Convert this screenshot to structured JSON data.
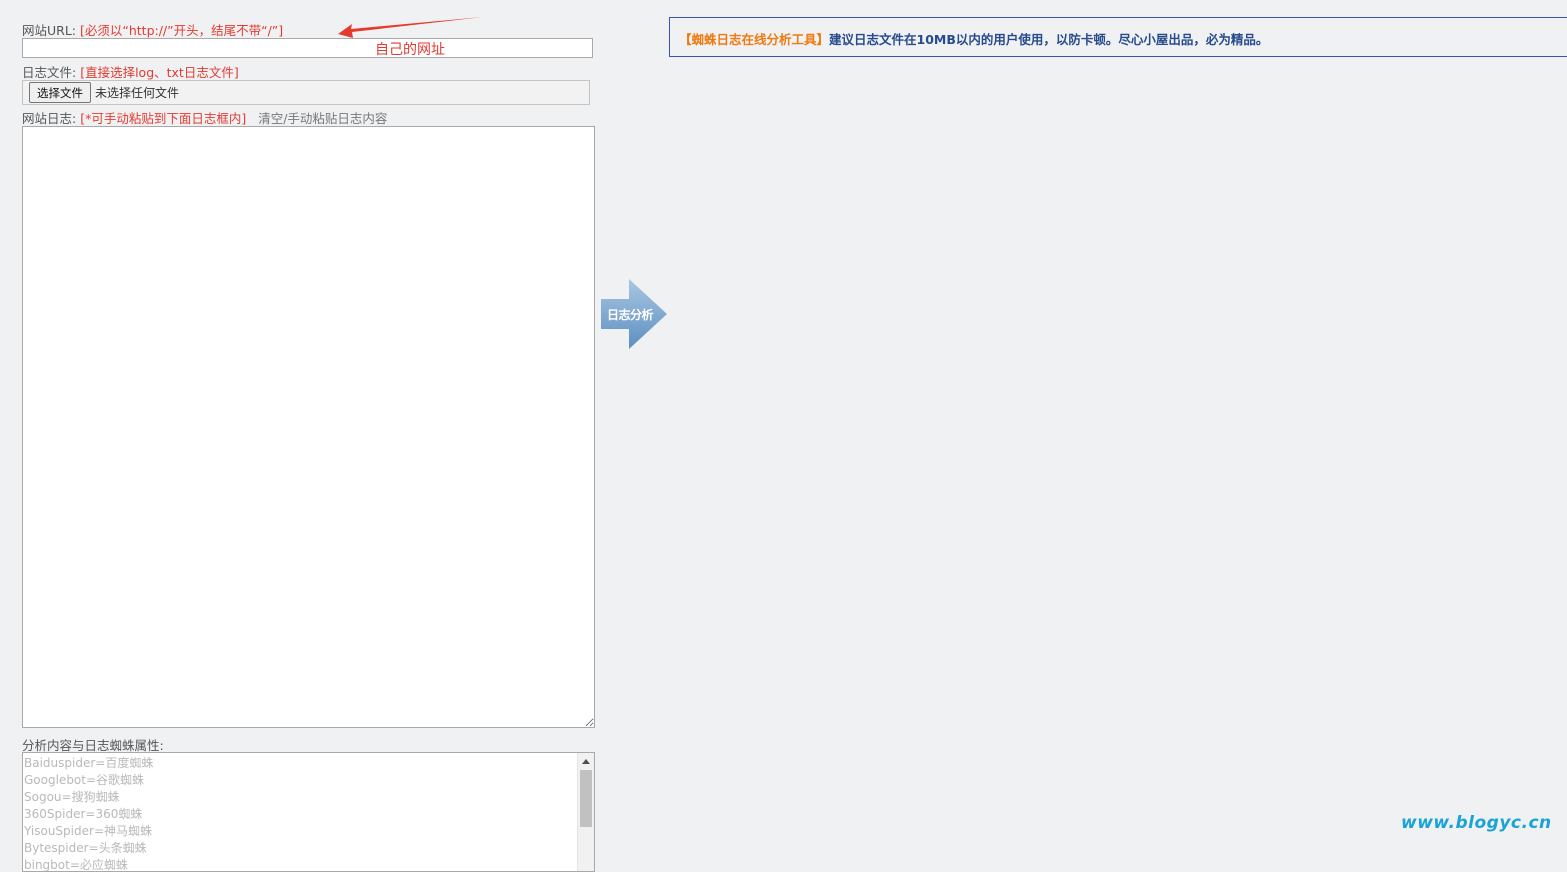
{
  "url_field": {
    "label": "网站URL:",
    "hint": "[必须以“http://”开头，结尾不带“/”]",
    "value": ""
  },
  "annotation": {
    "text": "自己的网址"
  },
  "file_field": {
    "label": "日志文件:",
    "hint": "[直接选择log、txt日志文件]",
    "button_label": "选择文件",
    "status": "未选择任何文件"
  },
  "log_field": {
    "label": "网站日志:",
    "hint": "[*可手动粘贴到下面日志框内]",
    "clear_link": "清空/手动粘贴日志内容",
    "value": ""
  },
  "spider_section": {
    "label": "分析内容与日志蜘蛛属性:",
    "items": [
      "Baiduspider=百度蜘蛛",
      "Googlebot=谷歌蜘蛛",
      "Sogou=搜狗蜘蛛",
      "360Spider=360蜘蛛",
      "YisouSpider=神马蜘蛛",
      "Bytespider=头条蜘蛛",
      "bingbot=必应蜘蛛"
    ]
  },
  "analyze_button": {
    "label": "日志分析",
    "color": "#7fa8cf"
  },
  "notice": {
    "title": "【蜘蛛日志在线分析工具】",
    "text": "建议日志文件在10MB以内的用户使用，以防卡顿。尽心小屋出品，必为精品。"
  },
  "watermark": {
    "text": "www.blogyc.cn"
  },
  "colors": {
    "hint_red": "#e53a2f",
    "notice_title": "#f07a10",
    "notice_text": "#274b8c",
    "notice_border": "#3a52b7",
    "watermark": "#1aa3d6"
  }
}
